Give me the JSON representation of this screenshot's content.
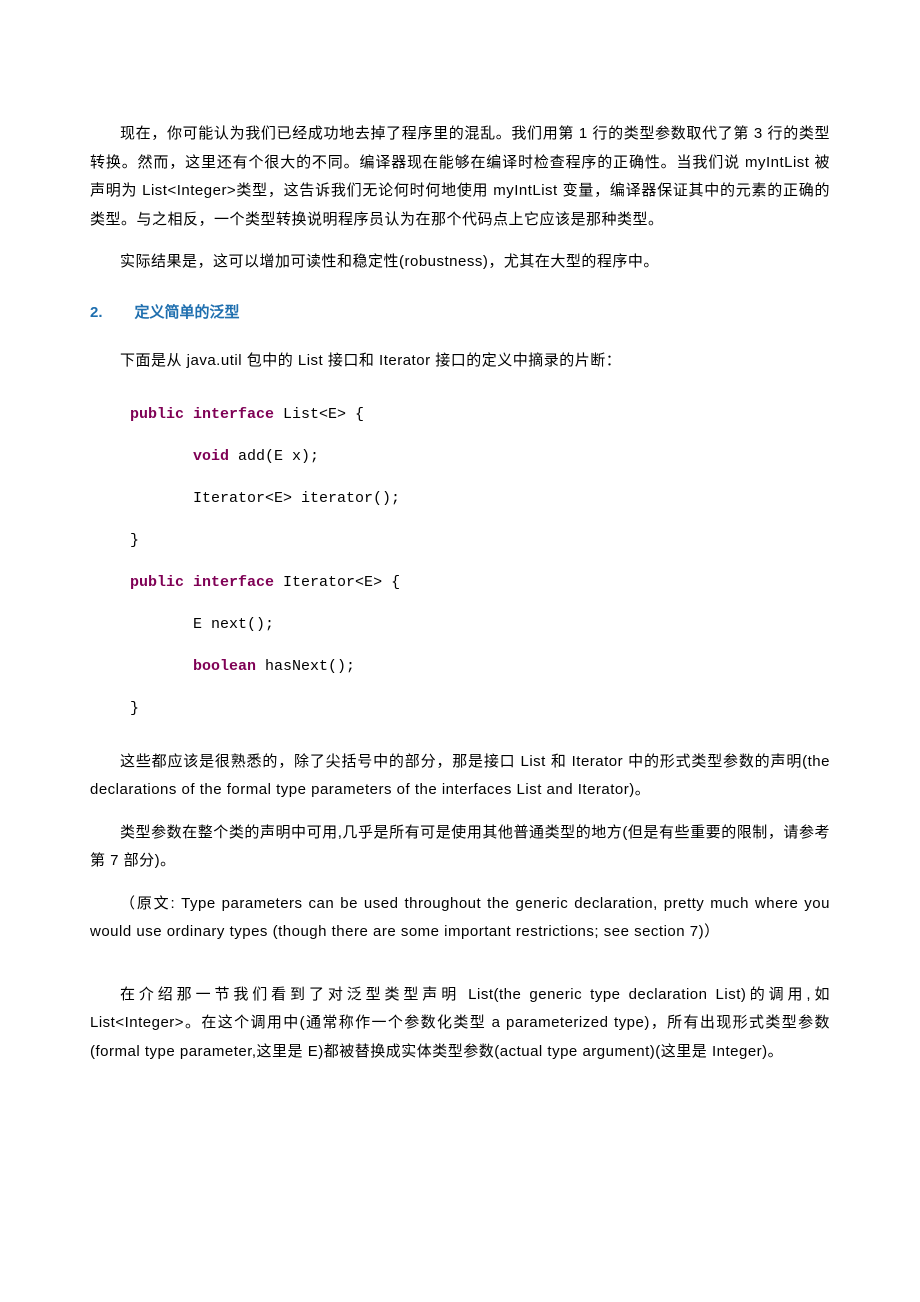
{
  "paragraphs": {
    "p1": "现在，你可能认为我们已经成功地去掉了程序里的混乱。我们用第 1 行的类型参数取代了第 3 行的类型转换。然而，这里还有个很大的不同。编译器现在能够在编译时检查程序的正确性。当我们说 myIntList 被声明为 List<Integer>类型，这告诉我们无论何时何地使用 myIntList 变量，编译器保证其中的元素的正确的类型。与之相反，一个类型转换说明程序员认为在那个代码点上它应该是那种类型。",
    "p2": "实际结果是，这可以增加可读性和稳定性(robustness)，尤其在大型的程序中。",
    "p3": "下面是从 java.util 包中的 List 接口和 Iterator 接口的定义中摘录的片断：",
    "p4": "这些都应该是很熟悉的，除了尖括号中的部分，那是接口 List 和 Iterator 中的形式类型参数的声明(the declarations of the formal type parameters of the interfaces List and Iterator)。",
    "p5": "类型参数在整个类的声明中可用,几乎是所有可是使用其他普通类型的地方(但是有些重要的限制，请参考第 7 部分)。",
    "p6": "（原文: Type parameters can be used throughout the generic declaration, pretty much where you would use ordinary types (though there are some important restrictions; see section 7)）",
    "p7": "在介绍那一节我们看到了对泛型类型声明 List(the generic type declaration List)的调用,如 List<Integer>。在这个调用中(通常称作一个参数化类型 a  parameterized type)，所有出现形式类型参数(formal type parameter,这里是 E)都被替换成实体类型参数(actual type argument)(这里是 Integer)。"
  },
  "heading": {
    "number": "2.",
    "title": "定义简单的泛型"
  },
  "code": {
    "kw_public": "public",
    "kw_interface": "interface",
    "kw_void": "void",
    "kw_boolean": "boolean",
    "list_decl": " List<E> {",
    "add_method": " add(E x);",
    "iterator_method": "Iterator<E> iterator();",
    "close_brace": "}",
    "iterator_decl": " Iterator<E> {",
    "next_method": "E next();",
    "hasnext_method": " hasNext();"
  }
}
